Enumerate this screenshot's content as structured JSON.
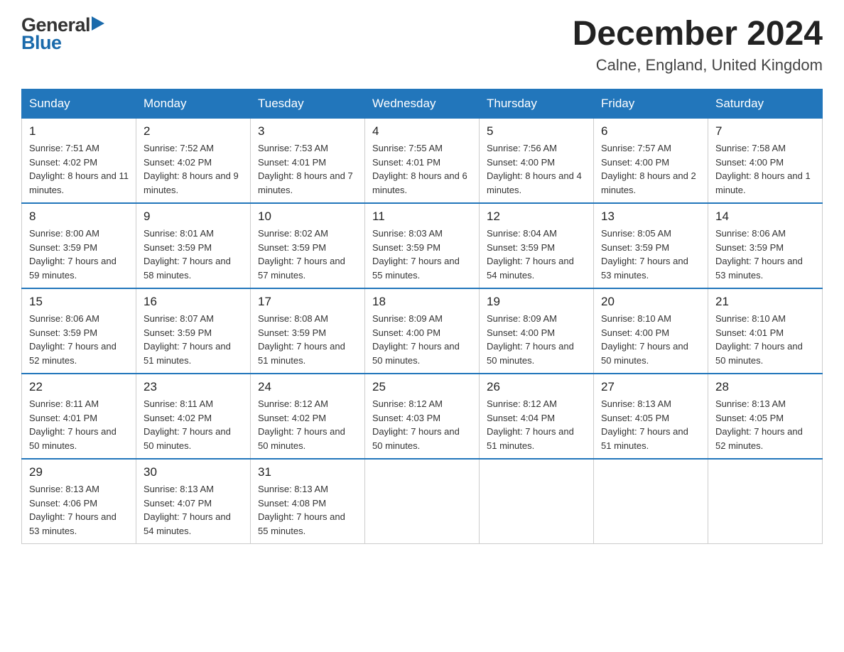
{
  "header": {
    "title": "December 2024",
    "subtitle": "Calne, England, United Kingdom",
    "logo_general": "General",
    "logo_blue": "Blue"
  },
  "days_of_week": [
    "Sunday",
    "Monday",
    "Tuesday",
    "Wednesday",
    "Thursday",
    "Friday",
    "Saturday"
  ],
  "weeks": [
    [
      {
        "day": "1",
        "sunrise": "7:51 AM",
        "sunset": "4:02 PM",
        "daylight": "8 hours and 11 minutes."
      },
      {
        "day": "2",
        "sunrise": "7:52 AM",
        "sunset": "4:02 PM",
        "daylight": "8 hours and 9 minutes."
      },
      {
        "day": "3",
        "sunrise": "7:53 AM",
        "sunset": "4:01 PM",
        "daylight": "8 hours and 7 minutes."
      },
      {
        "day": "4",
        "sunrise": "7:55 AM",
        "sunset": "4:01 PM",
        "daylight": "8 hours and 6 minutes."
      },
      {
        "day": "5",
        "sunrise": "7:56 AM",
        "sunset": "4:00 PM",
        "daylight": "8 hours and 4 minutes."
      },
      {
        "day": "6",
        "sunrise": "7:57 AM",
        "sunset": "4:00 PM",
        "daylight": "8 hours and 2 minutes."
      },
      {
        "day": "7",
        "sunrise": "7:58 AM",
        "sunset": "4:00 PM",
        "daylight": "8 hours and 1 minute."
      }
    ],
    [
      {
        "day": "8",
        "sunrise": "8:00 AM",
        "sunset": "3:59 PM",
        "daylight": "7 hours and 59 minutes."
      },
      {
        "day": "9",
        "sunrise": "8:01 AM",
        "sunset": "3:59 PM",
        "daylight": "7 hours and 58 minutes."
      },
      {
        "day": "10",
        "sunrise": "8:02 AM",
        "sunset": "3:59 PM",
        "daylight": "7 hours and 57 minutes."
      },
      {
        "day": "11",
        "sunrise": "8:03 AM",
        "sunset": "3:59 PM",
        "daylight": "7 hours and 55 minutes."
      },
      {
        "day": "12",
        "sunrise": "8:04 AM",
        "sunset": "3:59 PM",
        "daylight": "7 hours and 54 minutes."
      },
      {
        "day": "13",
        "sunrise": "8:05 AM",
        "sunset": "3:59 PM",
        "daylight": "7 hours and 53 minutes."
      },
      {
        "day": "14",
        "sunrise": "8:06 AM",
        "sunset": "3:59 PM",
        "daylight": "7 hours and 53 minutes."
      }
    ],
    [
      {
        "day": "15",
        "sunrise": "8:06 AM",
        "sunset": "3:59 PM",
        "daylight": "7 hours and 52 minutes."
      },
      {
        "day": "16",
        "sunrise": "8:07 AM",
        "sunset": "3:59 PM",
        "daylight": "7 hours and 51 minutes."
      },
      {
        "day": "17",
        "sunrise": "8:08 AM",
        "sunset": "3:59 PM",
        "daylight": "7 hours and 51 minutes."
      },
      {
        "day": "18",
        "sunrise": "8:09 AM",
        "sunset": "4:00 PM",
        "daylight": "7 hours and 50 minutes."
      },
      {
        "day": "19",
        "sunrise": "8:09 AM",
        "sunset": "4:00 PM",
        "daylight": "7 hours and 50 minutes."
      },
      {
        "day": "20",
        "sunrise": "8:10 AM",
        "sunset": "4:00 PM",
        "daylight": "7 hours and 50 minutes."
      },
      {
        "day": "21",
        "sunrise": "8:10 AM",
        "sunset": "4:01 PM",
        "daylight": "7 hours and 50 minutes."
      }
    ],
    [
      {
        "day": "22",
        "sunrise": "8:11 AM",
        "sunset": "4:01 PM",
        "daylight": "7 hours and 50 minutes."
      },
      {
        "day": "23",
        "sunrise": "8:11 AM",
        "sunset": "4:02 PM",
        "daylight": "7 hours and 50 minutes."
      },
      {
        "day": "24",
        "sunrise": "8:12 AM",
        "sunset": "4:02 PM",
        "daylight": "7 hours and 50 minutes."
      },
      {
        "day": "25",
        "sunrise": "8:12 AM",
        "sunset": "4:03 PM",
        "daylight": "7 hours and 50 minutes."
      },
      {
        "day": "26",
        "sunrise": "8:12 AM",
        "sunset": "4:04 PM",
        "daylight": "7 hours and 51 minutes."
      },
      {
        "day": "27",
        "sunrise": "8:13 AM",
        "sunset": "4:05 PM",
        "daylight": "7 hours and 51 minutes."
      },
      {
        "day": "28",
        "sunrise": "8:13 AM",
        "sunset": "4:05 PM",
        "daylight": "7 hours and 52 minutes."
      }
    ],
    [
      {
        "day": "29",
        "sunrise": "8:13 AM",
        "sunset": "4:06 PM",
        "daylight": "7 hours and 53 minutes."
      },
      {
        "day": "30",
        "sunrise": "8:13 AM",
        "sunset": "4:07 PM",
        "daylight": "7 hours and 54 minutes."
      },
      {
        "day": "31",
        "sunrise": "8:13 AM",
        "sunset": "4:08 PM",
        "daylight": "7 hours and 55 minutes."
      },
      null,
      null,
      null,
      null
    ]
  ],
  "labels": {
    "sunrise": "Sunrise:",
    "sunset": "Sunset:",
    "daylight": "Daylight:"
  }
}
